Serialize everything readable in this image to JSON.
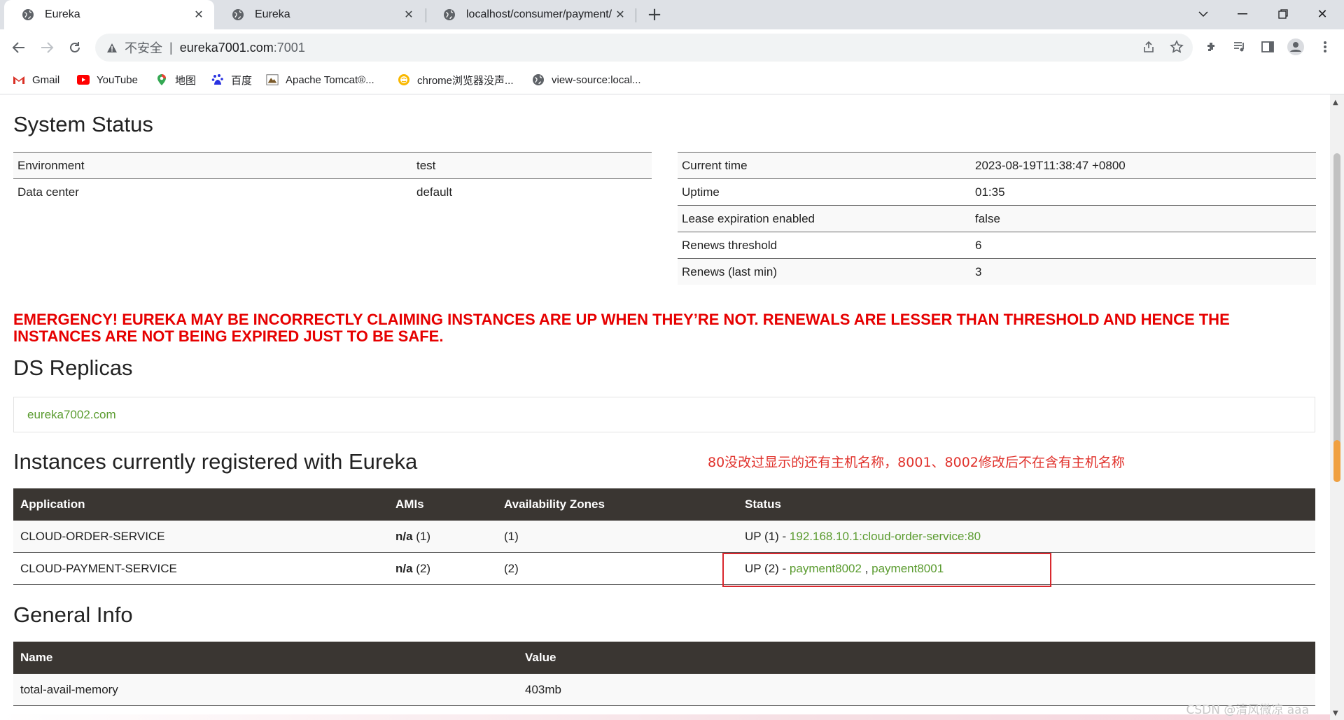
{
  "browser": {
    "tabs": [
      {
        "label": "Eureka",
        "active": true
      },
      {
        "label": "Eureka",
        "active": false
      },
      {
        "label": "localhost/consumer/payment/",
        "active": false
      }
    ],
    "address": {
      "insecure_label": "不安全",
      "host": "eureka7001.com",
      "port": ":7001"
    },
    "bookmarks": [
      {
        "label": "Gmail",
        "icon": "gmail-icon"
      },
      {
        "label": "YouTube",
        "icon": "youtube-icon"
      },
      {
        "label": "地图",
        "icon": "maps-icon"
      },
      {
        "label": "百度",
        "icon": "baidu-icon"
      },
      {
        "label": "Apache Tomcat®...",
        "icon": "tomcat-icon"
      },
      {
        "label": "chrome浏览器没声...",
        "icon": "chrome-tip-icon"
      },
      {
        "label": "view-source:local...",
        "icon": "globe-icon"
      }
    ]
  },
  "system_status": {
    "heading": "System Status",
    "left": [
      {
        "key": "Environment",
        "value": "test"
      },
      {
        "key": "Data center",
        "value": "default"
      }
    ],
    "right": [
      {
        "key": "Current time",
        "value": "2023-08-19T11:38:47 +0800"
      },
      {
        "key": "Uptime",
        "value": "01:35"
      },
      {
        "key": "Lease expiration enabled",
        "value": "false"
      },
      {
        "key": "Renews threshold",
        "value": "6"
      },
      {
        "key": "Renews (last min)",
        "value": "3"
      }
    ]
  },
  "emergency": "EMERGENCY! EUREKA MAY BE INCORRECTLY CLAIMING INSTANCES ARE UP WHEN THEY’RE NOT. RENEWALS ARE LESSER THAN THRESHOLD AND HENCE THE INSTANCES ARE NOT BEING EXPIRED JUST TO BE SAFE.",
  "replicas": {
    "heading": "DS Replicas",
    "items": [
      "eureka7002.com"
    ]
  },
  "instances": {
    "heading": "Instances currently registered with Eureka",
    "annotation": "80没改过显示的还有主机名称，8001、8002修改后不在含有主机名称",
    "columns": [
      "Application",
      "AMIs",
      "Availability Zones",
      "Status"
    ],
    "rows": [
      {
        "app": "CLOUD-ORDER-SERVICE",
        "amis_na": "n/a",
        "amis_count": "(1)",
        "zones": "(1)",
        "status_prefix": "UP (1) - ",
        "links": [
          "192.168.10.1:cloud-order-service:80"
        ],
        "sep": ""
      },
      {
        "app": "CLOUD-PAYMENT-SERVICE",
        "amis_na": "n/a",
        "amis_count": "(2)",
        "zones": "(2)",
        "status_prefix": "UP (2) - ",
        "links": [
          "payment8002",
          "payment8001"
        ],
        "sep": " , "
      }
    ]
  },
  "general_info": {
    "heading": "General Info",
    "columns": [
      "Name",
      "Value"
    ],
    "rows": [
      {
        "name": "total-avail-memory",
        "value": "403mb"
      }
    ]
  },
  "watermark": "CSDN @清风微凉 aaa",
  "colors": {
    "link": "#5a9b2f",
    "emergency": "#e60000",
    "table_header": "#3a3632",
    "annotation": "#e0312b"
  }
}
